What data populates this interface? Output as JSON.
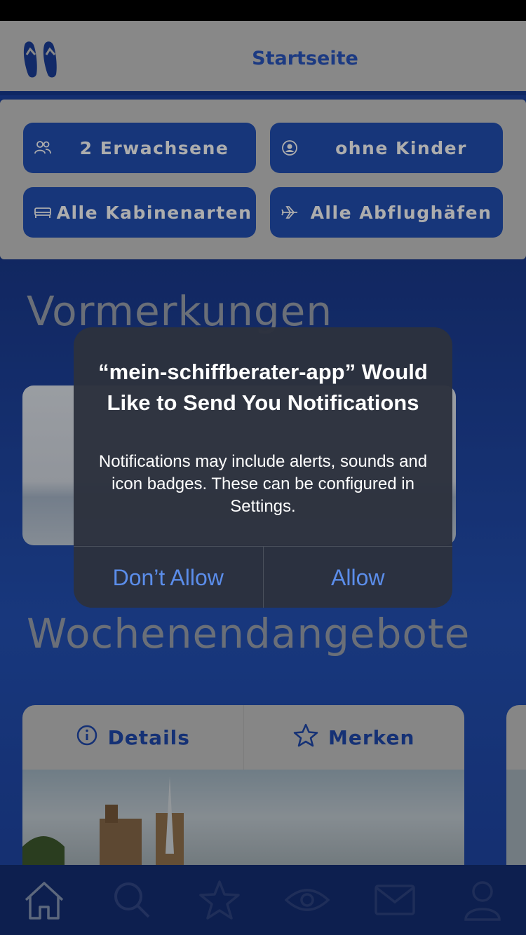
{
  "header": {
    "title": "Startseite",
    "logo_icon": "flip-flops-icon"
  },
  "filters": {
    "adults": {
      "label": "2 Erwachsene",
      "icon": "people-icon"
    },
    "children": {
      "label": "ohne Kinder",
      "icon": "user-circle-icon"
    },
    "cabins": {
      "label": "Alle Kabinenarten",
      "icon": "bed-icon"
    },
    "airports": {
      "label": "Alle Abflughäfen",
      "icon": "plane-icon"
    }
  },
  "sections": {
    "reservations_title": "Vormerkungen",
    "weekend_title": "Wochenendangebote"
  },
  "offer_card": {
    "details_label": "Details",
    "bookmark_label": "Merken"
  },
  "tabbar": [
    "home-icon",
    "search-icon",
    "star-icon",
    "eye-icon",
    "mail-icon",
    "user-icon"
  ],
  "alert": {
    "title": "“mein-schiffberater-app” Would Like to Send You Notifications",
    "message": "Notifications may include alerts, sounds and icon badges. These can be configured in Settings.",
    "deny_label": "Don’t Allow",
    "allow_label": "Allow"
  },
  "colors": {
    "accent": "#2350b4",
    "header_bg": "#c9c9c9",
    "alert_button": "#5b8dea"
  }
}
